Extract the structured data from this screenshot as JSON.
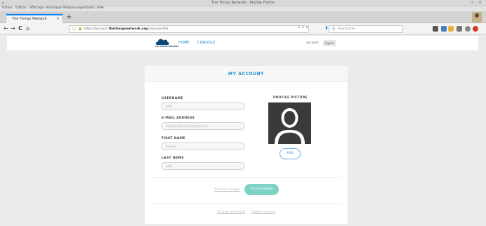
{
  "window": {
    "title": "The Things Network - Mozilla Firefox",
    "controls": "− ×"
  },
  "menubar": {
    "items": [
      "Fichier",
      "Édition",
      "Affichage",
      "Historique",
      "Marque-pages",
      "Outils",
      "Aide"
    ]
  },
  "tab": {
    "label": "The Things Network",
    "close": "×",
    "new": "+"
  },
  "navbar": {
    "back": "←",
    "forward": "→",
    "reload": "C",
    "home": "⌂",
    "url_prefix": "https://account.",
    "url_domain": "thethingsnetwork.org",
    "url_suffix": "/users/profile",
    "url_actions": "•••",
    "search_placeholder": "Rechercher"
  },
  "site": {
    "logo_text": "THE THINGS NETWORK",
    "nav": [
      "HOME",
      "CONSOLE"
    ],
    "account_label": "account",
    "logout_label": "logout"
  },
  "account": {
    "title": "MY ACCOUNT",
    "fields": [
      {
        "label": "USERNAME",
        "value": "antti"
      },
      {
        "label": "E-MAIL ADDRESS",
        "value": "magalie.abrassanleplaceis.ch"
      },
      {
        "label": "FIRST NAME",
        "value": "Fleister"
      },
      {
        "label": "LAST NAME",
        "value": "antti"
      }
    ],
    "profile_picture_label": "PROFILE PICTURE",
    "edit_label": "Edit",
    "discard_label": "Discard changes",
    "save_label": "Save changes",
    "change_password_label": "Change password",
    "delete_account_label": "Delete account"
  },
  "colors": {
    "accent": "#1890d6",
    "save_button": "#7ed3c4",
    "firefox_blue": "#0a84ff"
  }
}
